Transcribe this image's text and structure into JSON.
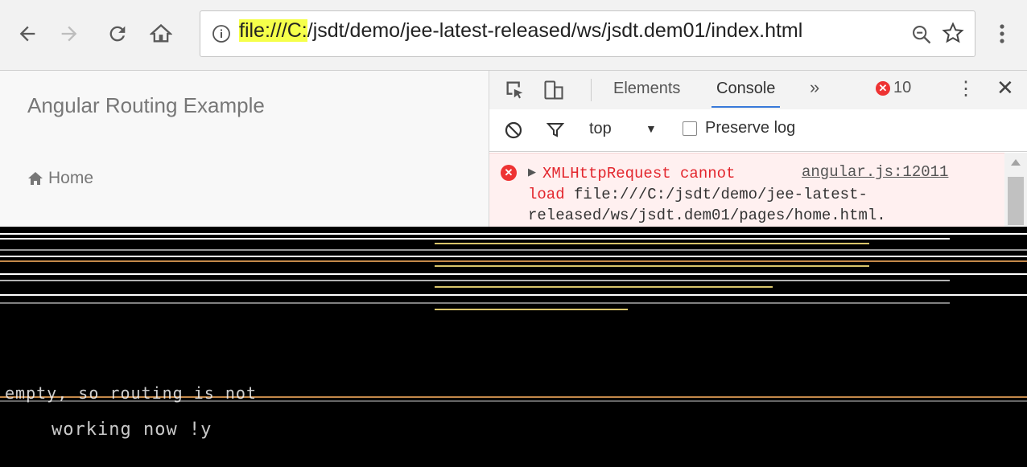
{
  "browser": {
    "url_prefix_highlight": "file:///C:",
    "url_rest": "/jsdt/demo/jee-latest-released/ws/jsdt.dem01/index.html",
    "icons": [
      "back-icon",
      "forward-icon",
      "reload-icon",
      "home-icon",
      "info-icon",
      "zoom-icon",
      "star-icon",
      "menu-icon"
    ]
  },
  "page": {
    "brand": "Angular Routing Example",
    "nav_home": "Home"
  },
  "devtools": {
    "tabs": [
      "Elements",
      "Console"
    ],
    "active_tab": "Console",
    "more_tabs": "»",
    "error_count": "10",
    "context": "top",
    "preserve_log": "Preserve log",
    "console_message": {
      "error_text": "XMLHttpRequest cannot",
      "source": "angular.js:12011",
      "line2_red": "load",
      "line2_rest": " file:///C:/jsdt/demo/jee-latest-",
      "line3": "released/ws/jsdt.dem01/pages/home.html."
    }
  },
  "glitch": {
    "fragments": [
      "empty, so routing is not",
      "working now !y"
    ]
  },
  "colors": {
    "url_highlight": "#f5ff4a",
    "error_red": "#e3262d",
    "console_error_bg": "#fff0f0",
    "active_tab_underline": "#3879d9"
  }
}
